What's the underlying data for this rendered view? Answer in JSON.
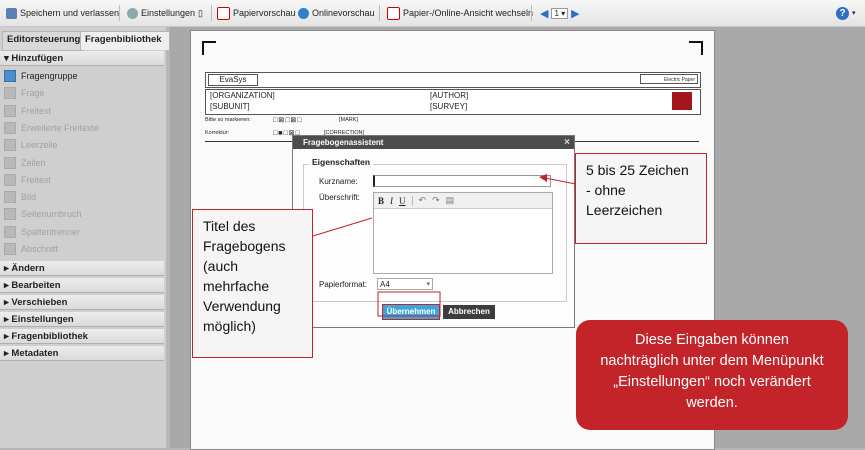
{
  "toolbar": {
    "save": "Speichern und verlassen",
    "settings": "Einstellungen",
    "paper_preview": "Papiervorschau",
    "online_preview": "Onlinevorschau",
    "switch_view": "Papier-/Online-Ansicht wechseln",
    "page": "1",
    "help": "?"
  },
  "left": {
    "tabs": [
      "Editorsteuerung",
      "Fragenbibliothek"
    ],
    "add_header": "Hinzufügen",
    "add_items": [
      {
        "label": "Fragengruppe",
        "enabled": true
      },
      {
        "label": "Frage",
        "enabled": false
      },
      {
        "label": "Freitext",
        "enabled": false
      },
      {
        "label": "Erweiterte Freitexte",
        "enabled": false
      },
      {
        "label": "Leerzeile",
        "enabled": false
      },
      {
        "label": "Zeilen",
        "enabled": false
      },
      {
        "label": "Freitext",
        "enabled": false
      },
      {
        "label": "Bild",
        "enabled": false
      },
      {
        "label": "Seitenumbruch",
        "enabled": false
      },
      {
        "label": "Spaltentrenner",
        "enabled": false
      },
      {
        "label": "Abschnitt",
        "enabled": false
      }
    ],
    "sections": [
      "Ändern",
      "Bearbeiten",
      "Verschieben",
      "Einstellungen",
      "Fragenbibliothek",
      "Metadaten"
    ]
  },
  "paper": {
    "brand": "EvaSys",
    "organization": "[ORGANIZATION]",
    "author": "[AUTHOR]",
    "subunit": "[SUBUNIT]",
    "survey": "[SURVEY]",
    "mark_label": "Bitte so markieren:",
    "mark_value": "[MARK]",
    "correction_label": "Korrektur:",
    "correction_value": "[CORRECTION]",
    "logo_text": "Electric Paper"
  },
  "dialog": {
    "title": "Fragebogenassistent",
    "fieldset": "Eigenschaften",
    "shortname_label": "Kurzname:",
    "shortname_value": "",
    "heading_label": "Überschrift:",
    "heading_value": "",
    "format_label": "Papierformat:",
    "format_value": "A4",
    "ok": "Übernehmen",
    "cancel": "Abbrechen"
  },
  "callouts": {
    "shortname": "5 bis 25 Zeichen - ohne Leerzeichen",
    "title": "Titel des Fragebogens (auch mehrfache Verwendung möglich)",
    "note": "Diese Eingaben können nachträglich unter dem Menüpunkt „Einstellungen“ noch verändert werden."
  },
  "colors": {
    "accent_red": "#c3242a",
    "button_blue": "#3aa6d9",
    "dialog_title": "#4c4c4c"
  }
}
